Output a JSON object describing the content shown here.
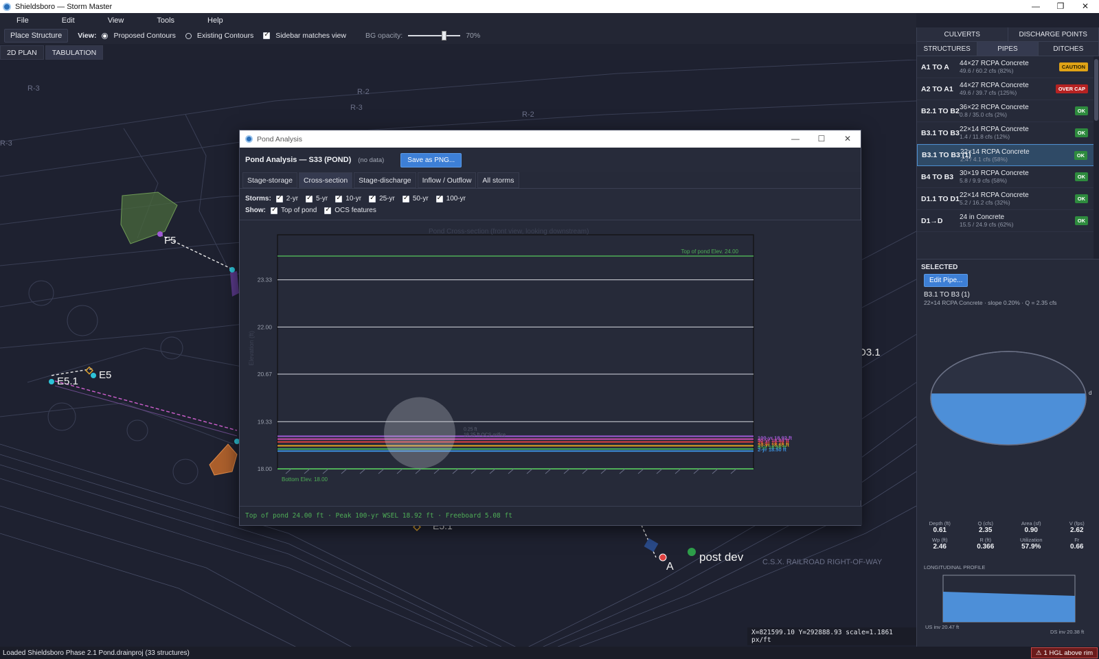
{
  "window": {
    "title": "Shieldsboro — Storm Master"
  },
  "menu": [
    "File",
    "Edit",
    "View",
    "Tools",
    "Help"
  ],
  "toolbar": {
    "place_structure": "Place Structure",
    "view_label": "View:",
    "proposed": "Proposed Contours",
    "existing": "Existing Contours",
    "sidebar_matches": "Sidebar matches view",
    "bg_opacity_label": "BG opacity:",
    "bg_opacity_value": "70%",
    "bg_opacity_fraction": 0.7
  },
  "view_tabs": [
    "2D PLAN",
    "TABULATION"
  ],
  "map": {
    "labels": [
      {
        "text": "F5"
      },
      {
        "text": "E5.1"
      },
      {
        "text": "E5"
      },
      {
        "text": "D3.1"
      },
      {
        "text": "A"
      },
      {
        "text": "post dev"
      },
      {
        "text": "E5.1"
      }
    ],
    "caption_railroad": "C.S.X. RAILROAD RIGHT-OF-WAY",
    "coords": "X=821599.10  Y=292888.93  scale=1.1861 px/ft"
  },
  "status": {
    "text": "Loaded Shieldsboro Phase 2.1 Pond.drainproj (33 structures)",
    "hgl_badge": "1 HGL above rim"
  },
  "sidebar": {
    "tabs_row1": [
      "CULVERTS",
      "DISCHARGE POINTS"
    ],
    "tabs_row2": [
      "STRUCTURES",
      "PIPES",
      "DITCHES"
    ],
    "pipes": [
      {
        "id": "A1 TO A",
        "desc": "44×27 RCPA Concrete",
        "flow": "49.6 / 60.2 cfs (82%)",
        "status": "CAUTION"
      },
      {
        "id": "A2 TO A1",
        "desc": "44×27 RCPA Concrete",
        "flow": "49.6 / 39.7 cfs (125%)",
        "status": "OVER CAP"
      },
      {
        "id": "B2.1 TO B2",
        "desc": "36×22 RCPA Concrete",
        "flow": "0.8 / 35.0 cfs (2%)",
        "status": "OK"
      },
      {
        "id": "B3.1 TO B3",
        "desc": "22×14 RCPA Concrete",
        "flow": "1.4 / 11.8 cfs (12%)",
        "status": "OK"
      },
      {
        "id": "B3.1 TO B3 (1)",
        "desc": "22×14 RCPA Concrete",
        "flow": "2.4 / 4.1 cfs (58%)",
        "status": "OK"
      },
      {
        "id": "B4 TO B3",
        "desc": "30×19 RCPA Concrete",
        "flow": "5.8 / 9.9 cfs (58%)",
        "status": "OK"
      },
      {
        "id": "D1.1 TO D1",
        "desc": "22×14 RCPA Concrete",
        "flow": "5.2 / 16.2 cfs (32%)",
        "status": "OK"
      },
      {
        "id": "D1→D",
        "desc": "24 in Concrete",
        "flow": "15.5 / 24.9 cfs (62%)",
        "status": "OK"
      }
    ],
    "selected_title": "SELECTED",
    "edit_button": "Edit Pipe...",
    "selected_name": "B3.1 TO B3 (1)",
    "selected_sub": "22×14 RCPA Concrete · slope 0.20% · Q = 2.35 cfs",
    "depth_label_short": "d",
    "stats": [
      {
        "label": "Depth (ft)",
        "value": "0.61"
      },
      {
        "label": "Q (cfs)",
        "value": "2.35"
      },
      {
        "label": "Area (sf)",
        "value": "0.90"
      },
      {
        "label": "V (fps)",
        "value": "2.62"
      },
      {
        "label": "Wp (ft)",
        "value": "2.46"
      },
      {
        "label": "R (ft)",
        "value": "0.366"
      },
      {
        "label": "Utilization",
        "value": "57.9%"
      },
      {
        "label": "Fr",
        "value": "0.66"
      }
    ],
    "profile_title": "LONGITUDINAL PROFILE",
    "profile_us": "US inv 20.47 ft",
    "profile_ds": "DS inv 20.38 ft",
    "fill_fraction": 0.55
  },
  "dialog": {
    "title": "Pond Analysis",
    "header": "Pond Analysis — S33 (POND)",
    "nodata": "(no data)",
    "save_png": "Save as PNG...",
    "tabs": [
      "Stage-storage",
      "Cross-section",
      "Stage-discharge",
      "Inflow / Outflow",
      "All storms"
    ],
    "storms_label": "Storms:",
    "storms": [
      "2-yr",
      "5-yr",
      "10-yr",
      "25-yr",
      "50-yr",
      "100-yr"
    ],
    "show_label": "Show:",
    "show": [
      "Top of pond",
      "OCS features"
    ],
    "footer": "Top of pond 24.00 ft  ·  Peak 100-yr WSEL 18.92 ft  ·  Freeboard 5.08 ft"
  },
  "chart_data": {
    "type": "line",
    "title": "Pond Cross-section (front view, looking downstream)",
    "ylabel": "Elevation (ft)",
    "xlabel": "",
    "ylim": [
      18.0,
      24.6
    ],
    "yticks": [
      18.0,
      19.33,
      20.67,
      22.0,
      23.33
    ],
    "grid": true,
    "top_of_pond": {
      "elev": 24.0,
      "label": "Top of pond Elev. 24.00"
    },
    "bottom": {
      "elev": 18.0,
      "label": "Bottom Elev. 18.00"
    },
    "outlet_label_1": "0.25 ft",
    "outlet_label_2": "18.25 ft OCS orifice",
    "storm_levels": [
      {
        "name": "100-yr",
        "elev": 18.92,
        "label": "100-yr 18.92 ft",
        "color": "#a05ad6"
      },
      {
        "name": "50-yr",
        "elev": 18.84,
        "label": "50-yr 18.84 ft",
        "color": "#d04db0"
      },
      {
        "name": "25-yr",
        "elev": 18.76,
        "label": "25-yr 18.76 ft",
        "color": "#d94040"
      },
      {
        "name": "10-yr",
        "elev": 18.65,
        "label": "10-yr 18.65 ft",
        "color": "#e0a020"
      },
      {
        "name": "5-yr",
        "elev": 18.56,
        "label": "5-yr 18.56 ft",
        "color": "#3fae5a"
      },
      {
        "name": "2-yr",
        "elev": 18.5,
        "label": "2-yr 18.50 ft",
        "color": "#3c8fdc"
      }
    ]
  }
}
